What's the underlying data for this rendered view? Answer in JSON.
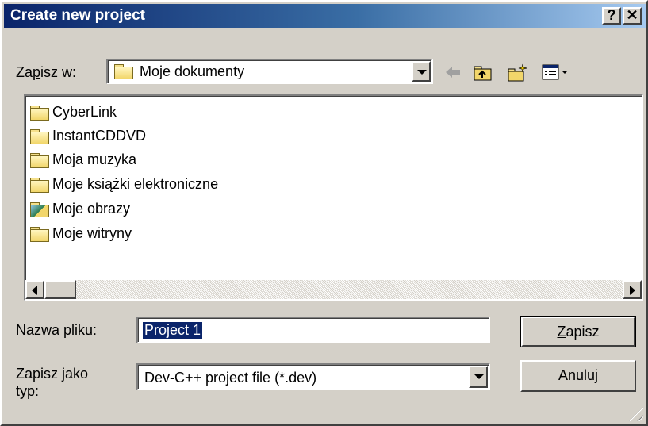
{
  "window": {
    "title": "Create new project",
    "help_label": "?",
    "close_label": "✕"
  },
  "save_in": {
    "label_pre": "Za",
    "label_accel": "p",
    "label_post": "isz w:",
    "value": "Moje dokumenty",
    "icon": "folder-icon"
  },
  "toolbar": {
    "back_icon": "back-arrow-icon",
    "up_icon": "up-folder-icon",
    "new_folder_icon": "new-folder-icon",
    "view_menu_icon": "view-menu-icon"
  },
  "files": [
    {
      "name": "CyberLink",
      "icon": "folder-icon"
    },
    {
      "name": "InstantCDDVD",
      "icon": "folder-icon"
    },
    {
      "name": "Moja muzyka",
      "icon": "folder-icon"
    },
    {
      "name": "Moje książki elektroniczne",
      "icon": "folder-icon"
    },
    {
      "name": "Moje obrazy",
      "icon": "picture-folder-icon"
    },
    {
      "name": "Moje witryny",
      "icon": "folder-icon"
    }
  ],
  "filename": {
    "label_accel": "N",
    "label_post": "azwa pliku:",
    "value": "Project 1"
  },
  "filetype": {
    "label_line1": "Zapisz jako",
    "label_accel": "t",
    "label_line2_post": "yp:",
    "value": "Dev-C++ project file (*.dev)"
  },
  "buttons": {
    "save_accel": "Z",
    "save_post": "apisz",
    "cancel": "Anuluj"
  },
  "colors": {
    "title_gradient_start": "#0a246a",
    "title_gradient_end": "#a6caf0",
    "selection": "#0a246a",
    "face": "#d4d0c8"
  }
}
